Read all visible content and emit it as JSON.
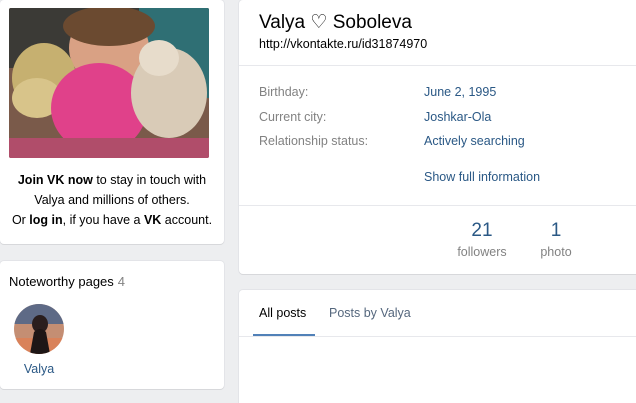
{
  "profile": {
    "name": "Valya ♡ Soboleva",
    "url": "http://vkontakte.ru/id31874970"
  },
  "join": {
    "join_bold": "Join VK now",
    "line1_rest": " to stay in touch with",
    "line2": "Valya and millions of others.",
    "line3_pre": "Or ",
    "login_bold": "log in",
    "line3_mid": ", if you have a ",
    "vk_bold": "VK",
    "line3_post": " account."
  },
  "noteworthy": {
    "title": "Noteworthy pages",
    "count": "4",
    "items": [
      {
        "name": "Valya"
      }
    ]
  },
  "info": {
    "birthday_label": "Birthday:",
    "birthday_value": "June 2, 1995",
    "city_label": "Current city:",
    "city_value": "Joshkar-Ola",
    "relationship_label": "Relationship status:",
    "relationship_value": "Actively searching",
    "show_full": "Show full information"
  },
  "counters": [
    {
      "num": "21",
      "label": "followers"
    },
    {
      "num": "1",
      "label": "photo"
    }
  ],
  "tabs": [
    {
      "label": "All posts",
      "active": true
    },
    {
      "label": "Posts by Valya",
      "active": false
    }
  ],
  "colors": {
    "link": "#2a5885",
    "accent": "#5181b8",
    "background": "#edeef0"
  }
}
